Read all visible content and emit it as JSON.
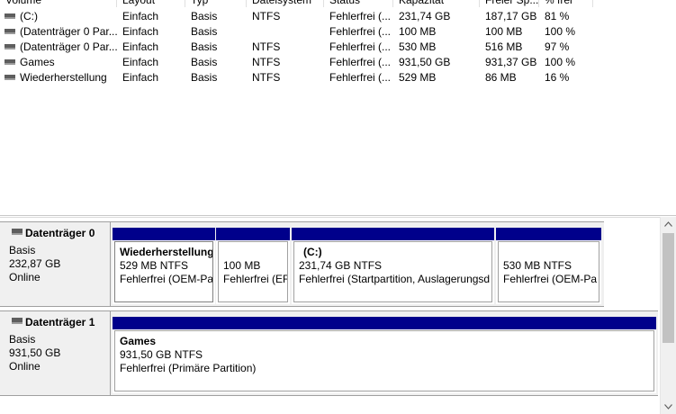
{
  "volume_list": {
    "columns": [
      "Volume",
      "Layout",
      "Typ",
      "Dateisystem",
      "Status",
      "Kapazität",
      "Freier Sp...",
      "% frei"
    ],
    "rows": [
      [
        "(C:)",
        "Einfach",
        "Basis",
        "NTFS",
        "Fehlerfrei (...",
        "231,74 GB",
        "187,17 GB",
        "81 %"
      ],
      [
        "(Datenträger 0 Par...",
        "Einfach",
        "Basis",
        "",
        "Fehlerfrei (...",
        "100 MB",
        "100 MB",
        "100 %"
      ],
      [
        "(Datenträger 0 Par...",
        "Einfach",
        "Basis",
        "NTFS",
        "Fehlerfrei (...",
        "530 MB",
        "516 MB",
        "97 %"
      ],
      [
        "Games",
        "Einfach",
        "Basis",
        "NTFS",
        "Fehlerfrei (...",
        "931,50 GB",
        "931,37 GB",
        "100 %"
      ],
      [
        "Wiederherstellung",
        "Einfach",
        "Basis",
        "NTFS",
        "Fehlerfrei (...",
        "529 MB",
        "86 MB",
        "16 %"
      ]
    ]
  },
  "disks": [
    {
      "title": "Datenträger 0",
      "type": "Basis",
      "size": "232,87 GB",
      "state": "Online",
      "partitions": [
        {
          "name": "Wiederherstellung",
          "size": "529 MB NTFS",
          "status": "Fehlerfrei (OEM-Pa"
        },
        {
          "name": "",
          "size": "100 MB",
          "status": "Fehlerfrei (EF"
        },
        {
          "name": "(C:)",
          "size": "231,74 GB NTFS",
          "status": "Fehlerfrei (Startpartition, Auslagerungsd"
        },
        {
          "name": "",
          "size": "530 MB NTFS",
          "status": "Fehlerfrei (OEM-Pa"
        }
      ]
    },
    {
      "title": "Datenträger 1",
      "type": "Basis",
      "size": "931,50 GB",
      "state": "Online",
      "partitions": [
        {
          "name": "Games",
          "size": "931,50 GB NTFS",
          "status": "Fehlerfrei (Primäre Partition)"
        }
      ]
    }
  ],
  "icons": {
    "volume": "drive-icon",
    "disk": "disk-icon",
    "scroll_up": "scroll-up-arrow-icon",
    "scroll_down": "scroll-down-arrow-icon"
  },
  "colors": {
    "partition_bar": "#00008b",
    "panel_bg": "#f0f0f0"
  }
}
